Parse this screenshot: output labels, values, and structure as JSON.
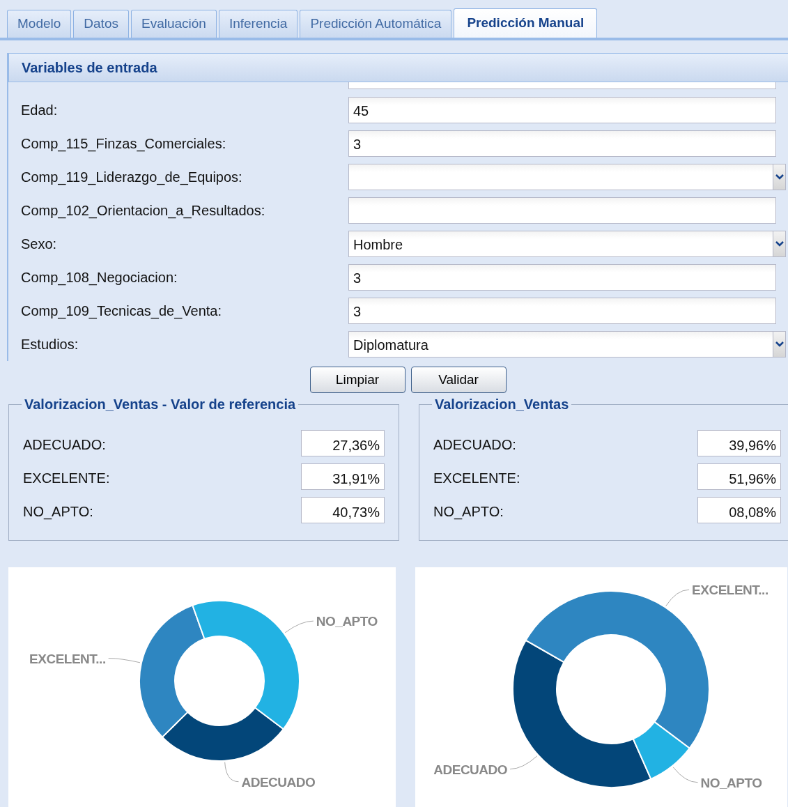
{
  "tabs": [
    {
      "label": "Modelo",
      "selected": false
    },
    {
      "label": "Datos",
      "selected": false
    },
    {
      "label": "Evaluación",
      "selected": false
    },
    {
      "label": "Inferencia",
      "selected": false
    },
    {
      "label": "Predicción Automática",
      "selected": false
    },
    {
      "label": "Predicción Manual",
      "selected": true
    }
  ],
  "panel": {
    "title": "Variables de entrada",
    "fields": [
      {
        "label": "Edad:",
        "value": "45",
        "kind": "text"
      },
      {
        "label": "Comp_115_Finzas_Comerciales:",
        "value": "3",
        "kind": "text"
      },
      {
        "label": "Comp_119_Liderazgo_de_Equipos:",
        "kind": "combo"
      },
      {
        "label": "Comp_102_Orientacion_a_Resultados:",
        "kind": "text"
      },
      {
        "label": "Sexo:",
        "value": "Hombre",
        "kind": "combo"
      },
      {
        "label": "Comp_108_Negociacion:",
        "value": "3",
        "kind": "text"
      },
      {
        "label": "Comp_109_Tecnicas_de_Venta:",
        "value": "3",
        "kind": "text"
      },
      {
        "label": "Estudios:",
        "value": "Diplomatura",
        "kind": "combo"
      }
    ],
    "buttons": [
      "Limpiar",
      "Validar"
    ]
  },
  "results": [
    {
      "title": "Valorizacion_Ventas - Valor de referencia",
      "rows": [
        {
          "label": "ADECUADO:",
          "value": "27,36%"
        },
        {
          "label": "EXCELENTE:",
          "value": "31,91%"
        },
        {
          "label": "NO_APTO:",
          "value": "40,73%"
        }
      ]
    },
    {
      "title": "Valorizacion_Ventas",
      "rows": [
        {
          "label": "ADECUADO:",
          "value": "39,96%"
        },
        {
          "label": "EXCELENTE:",
          "value": "51,96%"
        },
        {
          "label": "NO_APTO:",
          "value": "08,08%"
        }
      ]
    }
  ],
  "charts": [
    {
      "chart_data": {
        "type": "donut",
        "categories": [
          "ADECUADO",
          "EXCELENT...",
          "NO_APTO"
        ],
        "series": [
          {
            "values": [
              27.36,
              31.91,
              40.73
            ]
          }
        ],
        "colors": [
          "#034679",
          "#2e86c1",
          "#22b2e3"
        ]
      }
    },
    {
      "chart_data": {
        "type": "donut",
        "categories": [
          "ADECUADO",
          "EXCELENT...",
          "NO_APTO"
        ],
        "series": [
          {
            "values": [
              39.96,
              51.96,
              8.08
            ]
          }
        ],
        "colors": [
          "#034679",
          "#2e86c1",
          "#22b2e3"
        ]
      }
    }
  ]
}
